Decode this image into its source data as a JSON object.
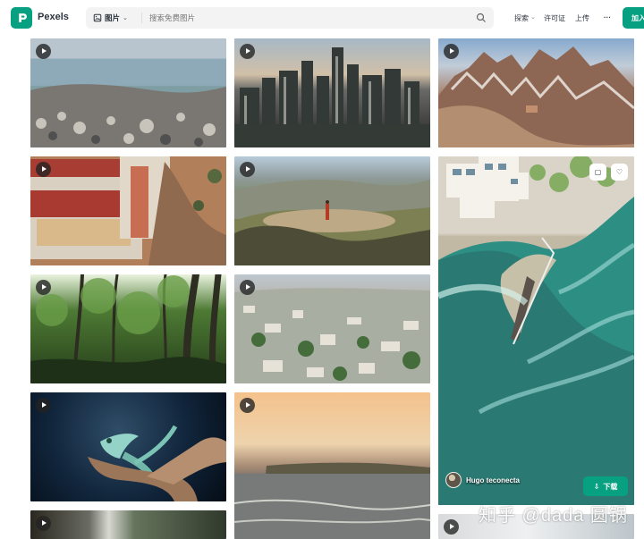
{
  "header": {
    "brand": "Pexels",
    "filter_label": "图片",
    "search_placeholder": "搜索免费图片",
    "nav": [
      "探索",
      "许可证",
      "上传",
      "···"
    ],
    "join_label": "加入"
  },
  "gallery": {
    "columns": [
      {
        "items": [
          "beach-stones-ocean",
          "castle-aerial",
          "forest-trees",
          "chameleon-branch",
          "waterfall-cliff"
        ]
      },
      {
        "items": [
          "city-skyline",
          "hill-lookout-person",
          "aerial-city",
          "sunset-sea"
        ]
      },
      {
        "items": [
          "mountain-peaks",
          "coastal-resort-aerial",
          "snowy-field"
        ]
      }
    ],
    "featured": {
      "author": "Hugo teconecta",
      "download_label": "下载",
      "actions": [
        "collection-icon",
        "heart-icon"
      ]
    }
  },
  "watermark": {
    "text": "知乎 @dada 圆锅"
  },
  "colors": {
    "brand_green": "#07a081",
    "search_bg": "#f3f3f3",
    "text": "#2c343e"
  }
}
